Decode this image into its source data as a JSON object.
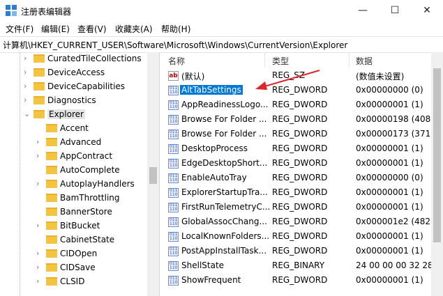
{
  "window": {
    "title": "注册表编辑器",
    "minimize": "—",
    "maximize": "☐",
    "close": "✕"
  },
  "menu": [
    "文件(F)",
    "编辑(E)",
    "查看(V)",
    "收藏夹(A)",
    "帮助(H)"
  ],
  "address": "计算机\\HKEY_CURRENT_USER\\Software\\Microsoft\\Windows\\CurrentVersion\\Explorer",
  "tree": {
    "items": [
      {
        "label": "CuratedTileCollections",
        "level": 0,
        "expander": ">"
      },
      {
        "label": "DeviceAccess",
        "level": 0,
        "expander": ">"
      },
      {
        "label": "DeviceCapabilities",
        "level": 0,
        "expander": ">"
      },
      {
        "label": "Diagnostics",
        "level": 0,
        "expander": ">"
      },
      {
        "label": "Explorer",
        "level": 0,
        "expander": "v",
        "selected": true
      },
      {
        "label": "Accent",
        "level": 1,
        "expander": ""
      },
      {
        "label": "Advanced",
        "level": 1,
        "expander": ">"
      },
      {
        "label": "AppContract",
        "level": 1,
        "expander": ">"
      },
      {
        "label": "AutoComplete",
        "level": 1,
        "expander": ""
      },
      {
        "label": "AutoplayHandlers",
        "level": 1,
        "expander": ">"
      },
      {
        "label": "BamThrottling",
        "level": 1,
        "expander": ""
      },
      {
        "label": "BannerStore",
        "level": 1,
        "expander": ""
      },
      {
        "label": "BitBucket",
        "level": 1,
        "expander": ">"
      },
      {
        "label": "CabinetState",
        "level": 1,
        "expander": ""
      },
      {
        "label": "CIDOpen",
        "level": 1,
        "expander": ">"
      },
      {
        "label": "CIDSave",
        "level": 1,
        "expander": ">"
      },
      {
        "label": "CLSID",
        "level": 1,
        "expander": ">"
      }
    ]
  },
  "list": {
    "headers": {
      "name": "名称",
      "type": "类型",
      "data": "数据"
    },
    "rows": [
      {
        "icon": "string-value-icon",
        "name": "(默认)",
        "type": "REG_SZ",
        "data": "(数值未设置)"
      },
      {
        "icon": "binary-value-icon",
        "name": "AltTabSettings",
        "type": "REG_DWORD",
        "data": "0x00000000 (0)",
        "selected": true
      },
      {
        "icon": "binary-value-icon",
        "name": "AppReadinessLogo...",
        "type": "REG_DWORD",
        "data": "0x00000001 (1)"
      },
      {
        "icon": "binary-value-icon",
        "name": "Browse For Folder ...",
        "type": "REG_DWORD",
        "data": "0x00000198 (408)"
      },
      {
        "icon": "binary-value-icon",
        "name": "Browse For Folder ...",
        "type": "REG_DWORD",
        "data": "0x00000173 (371)"
      },
      {
        "icon": "binary-value-icon",
        "name": "DesktopProcess",
        "type": "REG_DWORD",
        "data": "0x00000001 (1)"
      },
      {
        "icon": "binary-value-icon",
        "name": "EdgeDesktopShort...",
        "type": "REG_DWORD",
        "data": "0x00000001 (1)"
      },
      {
        "icon": "binary-value-icon",
        "name": "EnableAutoTray",
        "type": "REG_DWORD",
        "data": "0x00000000 (0)"
      },
      {
        "icon": "binary-value-icon",
        "name": "ExplorerStartupTra...",
        "type": "REG_DWORD",
        "data": "0x00000001 (1)"
      },
      {
        "icon": "binary-value-icon",
        "name": "FirstRunTelemetryC...",
        "type": "REG_DWORD",
        "data": "0x00000001 (1)"
      },
      {
        "icon": "binary-value-icon",
        "name": "GlobalAssocChang...",
        "type": "REG_DWORD",
        "data": "0x000001e2 (482)"
      },
      {
        "icon": "binary-value-icon",
        "name": "LocalKnownFolders...",
        "type": "REG_DWORD",
        "data": "0x00000001 (1)"
      },
      {
        "icon": "binary-value-icon",
        "name": "PostAppInstallTask...",
        "type": "REG_DWORD",
        "data": "0x00000001 (1)"
      },
      {
        "icon": "binary-value-icon",
        "name": "ShellState",
        "type": "REG_BINARY",
        "data": "24 00 00 00 32 28"
      },
      {
        "icon": "binary-value-icon",
        "name": "ShowFrequent",
        "type": "REG_DWORD",
        "data": "0x00000001 (1)"
      }
    ]
  },
  "colors": {
    "selection": "#0078d7",
    "annotation_arrow": "#e0242a",
    "folder": "#f3c342"
  }
}
